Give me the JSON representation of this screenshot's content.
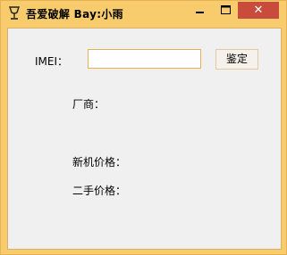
{
  "window": {
    "title": "吾爱破解    Bay:小雨",
    "icon": "cup-icon",
    "controls": {
      "minimize": "minimize-icon",
      "maximize": "maximize-icon",
      "close_glyph": "✕"
    },
    "colors": {
      "frame": "#f8cc6c",
      "close": "#c84b3c",
      "client": "#f0f0f0"
    }
  },
  "form": {
    "imei_label": "IMEI：",
    "imei_value": "",
    "check_button": "鉴定",
    "manufacturer_label": "厂商：",
    "new_price_label": "新机价格：",
    "used_price_label": "二手价格："
  }
}
